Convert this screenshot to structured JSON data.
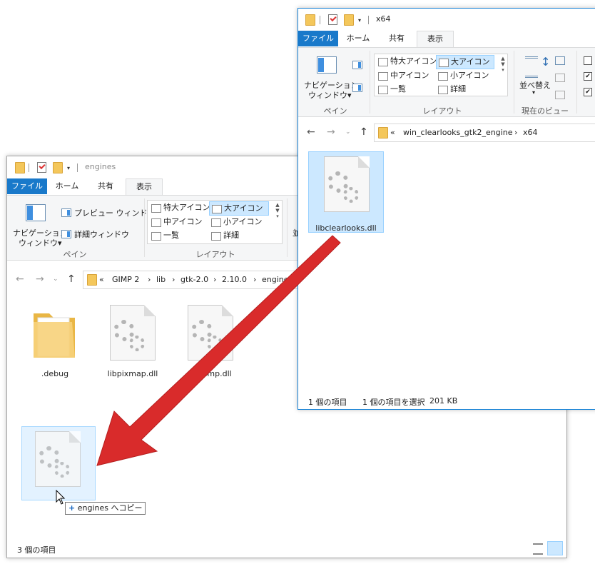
{
  "back_window": {
    "title": "engines",
    "tabs": [
      "ファイル",
      "ホーム",
      "共有",
      "表示"
    ],
    "ribbon": {
      "pane_group": {
        "nav_pane_label_1": "ナビゲーション",
        "nav_pane_label_2": "ウィンドウ▾",
        "preview_pane": "プレビュー ウィンドウ",
        "details_pane": "詳細ウィンドウ",
        "group_label": "ペイン"
      },
      "layout_group": {
        "items": [
          "特大アイコン",
          "大アイコン",
          "中アイコン",
          "小アイコン",
          "一覧",
          "詳細"
        ],
        "selected": "大アイコン",
        "group_label": "レイアウト"
      },
      "cut_label": "並"
    },
    "breadcrumb": [
      "«",
      "GIMP 2",
      "›",
      "lib",
      "›",
      "gtk-2.0",
      "›",
      "2.10.0",
      "›",
      "engines"
    ],
    "files": [
      ".debug",
      "libpixmap.dll",
      "libwimp.dll"
    ],
    "status": "3 個の項目"
  },
  "front_window": {
    "title": "x64",
    "tabs": [
      "ファイル",
      "ホーム",
      "共有",
      "表示"
    ],
    "ribbon": {
      "pane_group": {
        "nav_pane_label_1": "ナビゲーション",
        "nav_pane_label_2": "ウィンドウ▾",
        "group_label": "ペイン"
      },
      "layout_group": {
        "items": [
          "特大アイコン",
          "大アイコン",
          "中アイコン",
          "小アイコン",
          "一覧",
          "詳細"
        ],
        "selected": "大アイコン",
        "group_label": "レイアウト"
      },
      "view_group": {
        "sort_label": "並べ替え",
        "group_label": "現在のビュー"
      }
    },
    "breadcrumb": [
      "«",
      "win_clearlooks_gtk2_engine",
      "›",
      "x64"
    ],
    "files": [
      "libclearlooks.dll"
    ],
    "status_count": "1 個の項目",
    "status_selected": "1 個の項目を選択",
    "status_size": "201 KB"
  },
  "drag_tooltip": {
    "plus": "+",
    "text": "engines へコピー"
  },
  "colors": {
    "file_tab": "#1979ca",
    "selection": "#cce8ff",
    "arrow": "#d92b2b",
    "front_border": "#1883d7"
  }
}
